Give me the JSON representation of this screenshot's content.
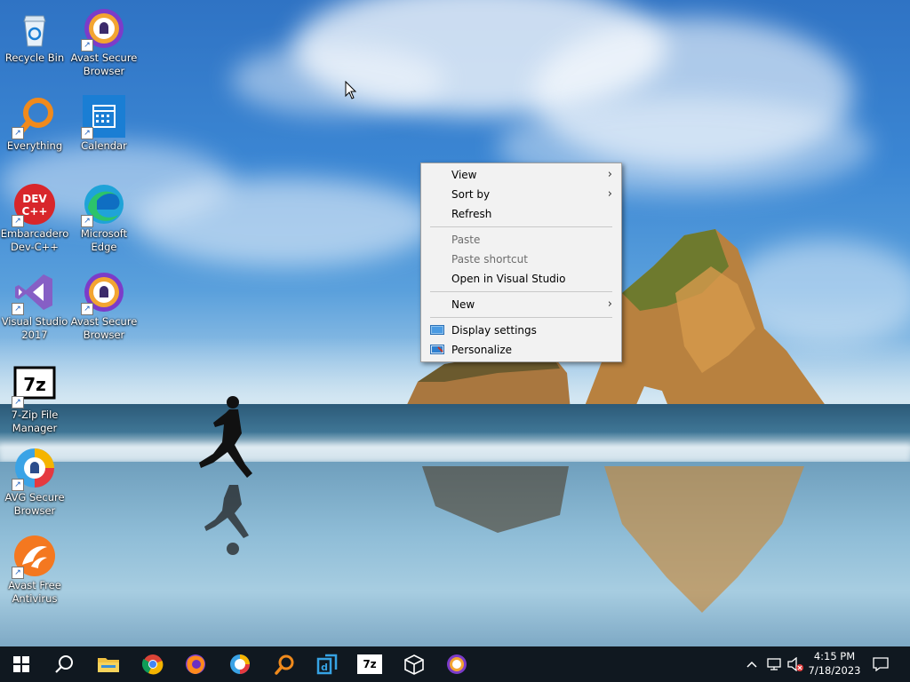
{
  "desktop": {
    "icons": [
      {
        "label": "Recycle Bin",
        "icon": "recycle-bin-icon",
        "shortcut": false
      },
      {
        "label": "Avast Secure Browser",
        "icon": "avast-browser-icon",
        "shortcut": true
      },
      {
        "label": "Everything",
        "icon": "everything-search-icon",
        "shortcut": true
      },
      {
        "label": "Calendar",
        "icon": "calendar-icon",
        "shortcut": true
      },
      {
        "label": "Embarcadero Dev-C++",
        "icon": "devcpp-icon",
        "shortcut": true
      },
      {
        "label": "Microsoft Edge",
        "icon": "edge-icon",
        "shortcut": true
      },
      {
        "label": "Visual Studio 2017",
        "icon": "visual-studio-icon",
        "shortcut": true
      },
      {
        "label": "Avast Secure Browser",
        "icon": "avast-browser-icon",
        "shortcut": true
      },
      {
        "label": "7-Zip File Manager",
        "icon": "7zip-icon",
        "shortcut": true
      },
      {
        "label": "AVG Secure Browser",
        "icon": "avg-browser-icon",
        "shortcut": true
      },
      {
        "label": "Avast Free Antivirus",
        "icon": "avast-antivirus-icon",
        "shortcut": true
      }
    ],
    "devcpp_badge": "DEV\nC++",
    "sevenzip_badge": "7z"
  },
  "context_menu": {
    "items": [
      {
        "label": "View",
        "submenu": true,
        "enabled": true
      },
      {
        "label": "Sort by",
        "submenu": true,
        "enabled": true
      },
      {
        "label": "Refresh",
        "submenu": false,
        "enabled": true
      },
      {
        "label": "Paste",
        "submenu": false,
        "enabled": false
      },
      {
        "label": "Paste shortcut",
        "submenu": false,
        "enabled": false
      },
      {
        "label": "Open in Visual Studio",
        "submenu": false,
        "enabled": true
      },
      {
        "label": "New",
        "submenu": true,
        "enabled": true
      },
      {
        "label": "Display settings",
        "submenu": false,
        "enabled": true,
        "icon": "display-settings-icon"
      },
      {
        "label": "Personalize",
        "submenu": false,
        "enabled": true,
        "icon": "personalize-icon"
      }
    ]
  },
  "taskbar": {
    "pinned": [
      "start-icon",
      "search-icon",
      "file-explorer-icon",
      "chrome-icon",
      "firefox-icon",
      "avast-browser-icon",
      "everything-icon",
      "dev-tool-icon",
      "7zip-icon",
      "3d-box-icon",
      "avast-secure-icon"
    ],
    "clock": {
      "time": "4:15 PM",
      "date": "7/18/2023"
    },
    "tray": [
      "chevron-up-icon",
      "network-icon",
      "volume-muted-icon",
      "notification-icon"
    ],
    "sevenzip_label": "7z"
  },
  "colors": {
    "taskbar": "#101820",
    "menu_bg": "#f2f2f2",
    "accent": "#0078d7"
  }
}
